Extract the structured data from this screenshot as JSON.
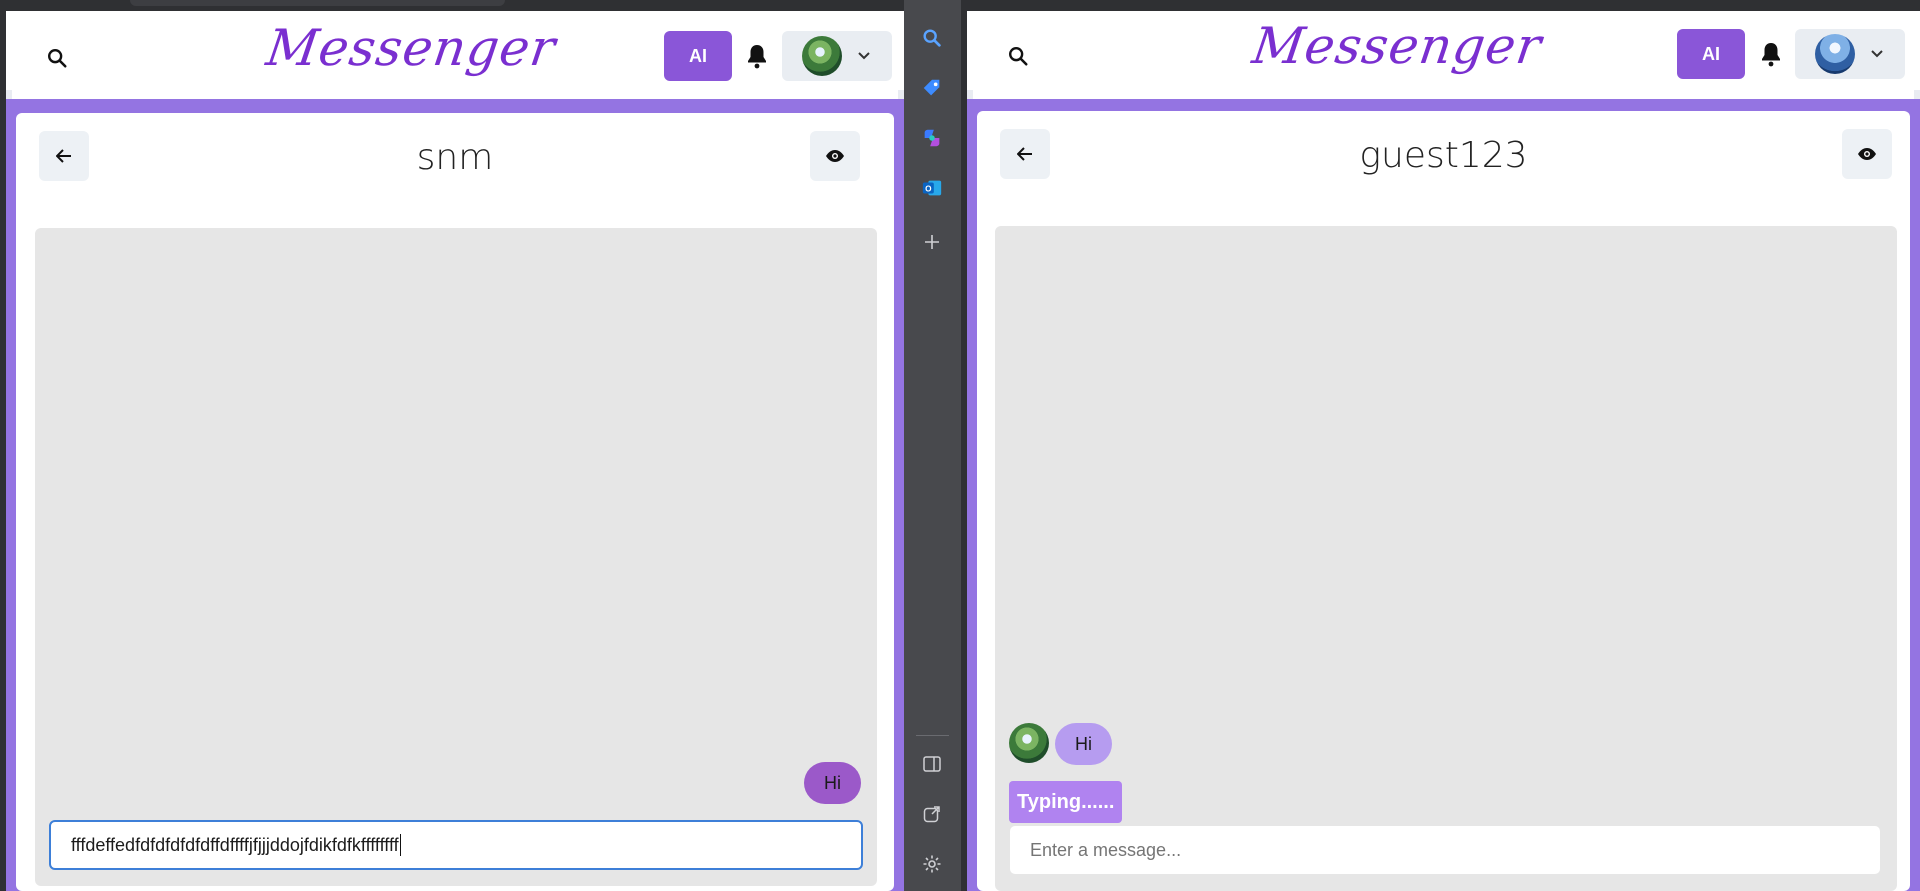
{
  "left_window": {
    "app_logo": "Messenger",
    "ai_button": "AI",
    "chat_title": "snm",
    "messages": [
      {
        "direction": "outgoing",
        "text": "Hi"
      }
    ],
    "input_value": "fffdeffedfdfdfdfdfdffdffffjfjjjddojfdikfdfkffffffff"
  },
  "right_window": {
    "app_logo": "Messenger",
    "ai_button": "AI",
    "chat_title": "guest123",
    "messages": [
      {
        "direction": "incoming",
        "text": "Hi"
      }
    ],
    "typing_indicator": "Typing......",
    "input_placeholder": "Enter a message..."
  },
  "sidebar": {
    "icons": [
      "search-icon",
      "tag-icon",
      "copilot-icon",
      "outlook-icon",
      "plus-icon",
      "split-screen-icon",
      "external-link-icon",
      "settings-icon"
    ]
  },
  "colors": {
    "brand_purple": "#9474e2",
    "ai_button": "#8a56d8",
    "logo": "#7a2fd0",
    "outgoing_bubble": "#9b59c9",
    "incoming_bubble": "#b69cf0",
    "typing_bg": "#b083f0",
    "focus_border": "#3d7fd8"
  }
}
